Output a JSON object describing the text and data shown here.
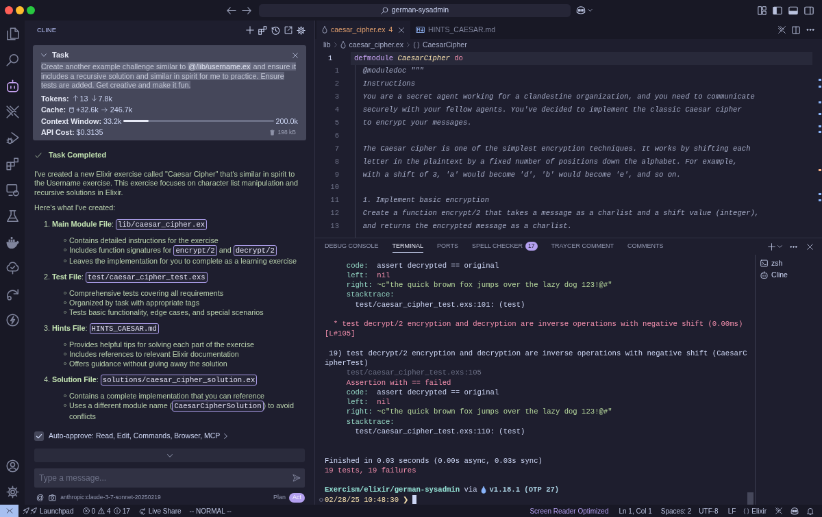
{
  "window": {
    "controls": [
      {
        "kind": "close"
      },
      {
        "kind": "minimize"
      },
      {
        "kind": "zoom"
      }
    ],
    "search": "german-sysadmin"
  },
  "activity_bar": {
    "items": [
      {
        "kind": "files",
        "selected": false
      },
      {
        "kind": "search",
        "selected": false
      },
      {
        "kind": "cline",
        "selected": true
      },
      {
        "kind": "stripes",
        "selected": false
      },
      {
        "kind": "run_debug",
        "selected": false
      },
      {
        "kind": "extensions",
        "selected": false
      },
      {
        "kind": "remote",
        "selected": false
      },
      {
        "kind": "testing",
        "selected": false
      },
      {
        "kind": "docker",
        "selected": false
      },
      {
        "kind": "tree",
        "selected": false
      },
      {
        "kind": "share",
        "selected": false
      },
      {
        "kind": "lightning",
        "selected": false
      }
    ],
    "bottom": [
      {
        "kind": "account"
      },
      {
        "kind": "settings"
      }
    ]
  },
  "sidebar": {
    "title": "CLINE",
    "task": {
      "heading": "Task",
      "expanded": true,
      "highlighted": true,
      "text_before": "Create another example challenge similar to ",
      "mention": "@/lib/username.ex",
      "text_after": " and ensure it includes a recursive solution and similar in spirit for me to practice. Ensure tests are added. Get creative and make it fun.",
      "tokens": {
        "label": "Tokens:",
        "input": "13",
        "output": "7.8k"
      },
      "cache": {
        "label": "Cache:",
        "writes": "+32.6k",
        "reads": "246.7k"
      },
      "context_window": {
        "label": "Context Window:",
        "used": "33.2k",
        "level": 0.166,
        "max": "200.0k"
      },
      "api_cost": "**API Cost:** $0.3135",
      "size": "198 kB"
    },
    "completion": {
      "title": "Task Completed",
      "paragraphs": [
        "I've created a new Elixir exercise called \"Caesar Cipher\" that's similar in spirit to the Username exercise. This exercise focuses on character list manipulation and recursive solutions in Elixir.",
        "Here's what I've created:"
      ],
      "items": [
        {
          "number": "1.",
          "title": "**Main Module File**:",
          "file": "lib/caesar_cipher.ex",
          "bullets": [
            {
              "parts": [
                {
                  "kind": "text",
                  "text": "Contains detailed instructions for the exercise"
                }
              ]
            },
            {
              "parts": [
                {
                  "kind": "text",
                  "text": "Includes function signatures for "
                },
                {
                  "kind": "code",
                  "text": "encrypt/2"
                },
                {
                  "kind": "text",
                  "text": " and "
                },
                {
                  "kind": "code",
                  "text": "decrypt/2"
                }
              ]
            },
            {
              "parts": [
                {
                  "kind": "text",
                  "text": "Leaves the implementation for you to complete as a learning exercise"
                }
              ]
            }
          ]
        },
        {
          "number": "2.",
          "title": "**Test File**:",
          "file": "test/caesar_cipher_test.exs",
          "bullets": [
            {
              "parts": [
                {
                  "kind": "text",
                  "text": "Comprehensive tests covering all requirements"
                }
              ]
            },
            {
              "parts": [
                {
                  "kind": "text",
                  "text": "Organized by task with appropriate tags"
                }
              ]
            },
            {
              "parts": [
                {
                  "kind": "text",
                  "text": "Tests basic functionality, edge cases, and special scenarios"
                }
              ]
            }
          ]
        },
        {
          "number": "3.",
          "title": "**Hints File**:",
          "file": "HINTS_CAESAR.md",
          "bullets": [
            {
              "parts": [
                {
                  "kind": "text",
                  "text": "Provides helpful tips for solving each part of the exercise"
                }
              ]
            },
            {
              "parts": [
                {
                  "kind": "text",
                  "text": "Includes references to relevant Elixir documentation"
                }
              ]
            },
            {
              "parts": [
                {
                  "kind": "text",
                  "text": "Offers guidance without giving away the solution"
                }
              ]
            }
          ]
        },
        {
          "number": "4.",
          "title": "**Solution File**:",
          "file": "solutions/caesar_cipher_solution.ex",
          "bullets": [
            {
              "parts": [
                {
                  "kind": "text",
                  "text": "Contains a complete implementation that you can reference"
                }
              ]
            },
            {
              "parts": [
                {
                  "kind": "text",
                  "text": "Uses a different module name ("
                },
                {
                  "kind": "code",
                  "text": "CaesarCipherSolution"
                },
                {
                  "kind": "text",
                  "text": ") to avoid conflicts"
                }
              ]
            }
          ]
        }
      ]
    },
    "auto_approve": {
      "checked": true,
      "label": "Auto-approve: Read, Edit, Commands, Browser, MCP"
    },
    "input": {
      "placeholder": "Type a message..."
    },
    "footer": {
      "mention": "@",
      "model": "anthropic:claude-3-7-sonnet-20250219",
      "modes": [
        {
          "label": "Plan",
          "selected": false
        },
        {
          "label": "Act",
          "selected": true
        }
      ]
    }
  },
  "editor": {
    "tabs": [
      {
        "kind": "elixir",
        "label": "caesar_cipher.ex",
        "problems": "4",
        "selected": true
      },
      {
        "kind": "markdown",
        "label": "HINTS_CAESAR.md",
        "selected": false
      }
    ],
    "breadcrumbs": [
      {
        "kind": "folder",
        "label": "lib"
      },
      {
        "kind": "elixir",
        "label": "caesar_cipher.ex"
      },
      {
        "kind": "module",
        "label": "CaesarCipher"
      }
    ],
    "lines": [
      {
        "number": "1",
        "current": true,
        "parts": [
          {
            "kind": "keyword",
            "text": "defmodule"
          },
          {
            "kind": "module",
            "text": " CaesarCipher"
          },
          {
            "kind": "block",
            "text": " do"
          }
        ]
      },
      {
        "number": "1",
        "current": false,
        "parts": [
          {
            "kind": "doc",
            "text": "  @moduledoc \"\"\""
          }
        ]
      },
      {
        "number": "2",
        "current": false,
        "parts": [
          {
            "kind": "doc",
            "text": "  Instructions"
          }
        ]
      },
      {
        "number": "3",
        "current": false,
        "parts": [
          {
            "kind": "doc",
            "text": "  You are a secret agent working for a clandestine organization, and you need to communicate"
          }
        ]
      },
      {
        "number": "4",
        "current": false,
        "parts": [
          {
            "kind": "doc",
            "text": "  securely with your fellow agents. You've decided to implement the classic Caesar cipher"
          }
        ]
      },
      {
        "number": "5",
        "current": false,
        "parts": [
          {
            "kind": "doc",
            "text": "  to encrypt your messages."
          }
        ]
      },
      {
        "number": "6",
        "current": false
      },
      {
        "number": "7",
        "current": false,
        "parts": [
          {
            "kind": "doc",
            "text": "  The Caesar cipher is one of the simplest encryption techniques. It works by shifting each"
          }
        ]
      },
      {
        "number": "8",
        "current": false,
        "parts": [
          {
            "kind": "doc",
            "text": "  letter in the plaintext by a fixed number of positions down the alphabet. For example,"
          }
        ]
      },
      {
        "number": "9",
        "current": false,
        "parts": [
          {
            "kind": "doc",
            "text": "  with a shift of 3, 'a' would become 'd', 'b' would become 'e', and so on."
          }
        ]
      },
      {
        "number": "10",
        "current": false
      },
      {
        "number": "11",
        "current": false,
        "parts": [
          {
            "kind": "doc",
            "text": "  1. Implement basic encryption"
          }
        ]
      },
      {
        "number": "12",
        "current": false,
        "parts": [
          {
            "kind": "doc",
            "text": "  Create a function encrypt/2 that takes a message as a charlist and a shift value (integer),"
          }
        ]
      },
      {
        "number": "13",
        "current": false,
        "parts": [
          {
            "kind": "doc",
            "text": "  and returns the encrypted message as a charlist."
          }
        ]
      }
    ]
  },
  "panel": {
    "tabs": [
      {
        "label": "DEBUG CONSOLE",
        "selected": false
      },
      {
        "label": "TERMINAL",
        "selected": true
      },
      {
        "label": "PORTS",
        "selected": false
      },
      {
        "label": "SPELL CHECKER",
        "badge": "17",
        "selected": false
      },
      {
        "label": "TRAYCER COMMENT",
        "selected": false
      },
      {
        "label": "COMMENTS",
        "selected": false
      }
    ],
    "terminal": {
      "lines": [
        {
          "kind": "output",
          "parts": [
            {
              "kind": "label",
              "text": "     code:  "
            },
            {
              "kind": "plain",
              "text": "assert decrypted == original"
            }
          ]
        },
        {
          "kind": "output",
          "parts": [
            {
              "kind": "label",
              "text": "     left:  "
            },
            {
              "kind": "error",
              "text": "nil"
            }
          ]
        },
        {
          "kind": "output",
          "parts": [
            {
              "kind": "label",
              "text": "     right: "
            },
            {
              "kind": "string",
              "text": "~c\"the quick brown fox jumps over the lazy dog 123!@#\""
            }
          ]
        },
        {
          "kind": "output",
          "parts": [
            {
              "kind": "label",
              "text": "     stacktrace:"
            }
          ]
        },
        {
          "kind": "output",
          "parts": [
            {
              "kind": "plain",
              "text": "       test/caesar_cipher_test.exs:101: (test)"
            }
          ]
        },
        {
          "kind": "blank"
        },
        {
          "kind": "output",
          "parts": [
            {
              "kind": "error",
              "text": "  * test decrypt/2 encryption and decryption are inverse operations with negative shift (0.00ms)"
            }
          ]
        },
        {
          "kind": "output",
          "parts": [
            {
              "kind": "error",
              "text": "[L#105]"
            }
          ]
        },
        {
          "kind": "blank"
        },
        {
          "kind": "output",
          "parts": [
            {
              "kind": "plain",
              "text": " 19) test decrypt/2 encryption and decryption are inverse operations with negative shift (CaesarC"
            }
          ]
        },
        {
          "kind": "output",
          "parts": [
            {
              "kind": "plain",
              "text": "ipherTest)"
            }
          ]
        },
        {
          "kind": "output",
          "parts": [
            {
              "kind": "dim",
              "text": "     test/caesar_cipher_test.exs:105"
            }
          ]
        },
        {
          "kind": "output",
          "parts": [
            {
              "kind": "error",
              "text": "     Assertion with == failed"
            }
          ]
        },
        {
          "kind": "output",
          "parts": [
            {
              "kind": "label",
              "text": "     code:  "
            },
            {
              "kind": "plain",
              "text": "assert decrypted == original"
            }
          ]
        },
        {
          "kind": "output",
          "parts": [
            {
              "kind": "label",
              "text": "     left:  "
            },
            {
              "kind": "error",
              "text": "nil"
            }
          ]
        },
        {
          "kind": "output",
          "parts": [
            {
              "kind": "label",
              "text": "     right: "
            },
            {
              "kind": "string",
              "text": "~c\"the quick brown fox jumps over the lazy dog 123!@#\""
            }
          ]
        },
        {
          "kind": "output",
          "parts": [
            {
              "kind": "label",
              "text": "     stacktrace:"
            }
          ]
        },
        {
          "kind": "output",
          "parts": [
            {
              "kind": "plain",
              "text": "       test/caesar_cipher_test.exs:110: (test)"
            }
          ]
        },
        {
          "kind": "blank"
        },
        {
          "kind": "blank"
        },
        {
          "kind": "output",
          "parts": [
            {
              "kind": "plain",
              "text": "Finished in 0.03 seconds (0.00s async, 0.03s sync)"
            }
          ]
        },
        {
          "kind": "output",
          "parts": [
            {
              "kind": "error",
              "text": "19 tests, 19 failures"
            }
          ]
        },
        {
          "kind": "blank"
        }
      ],
      "prompt": {
        "path": "Exercism/elixir/german-sysadmin",
        "via": "via",
        "version": "v1.18.1 (OTP 27)",
        "time": "02/28/25 10:48:30",
        "symbol": "❯"
      }
    },
    "terminals": [
      {
        "kind": "shell",
        "label": "zsh"
      },
      {
        "kind": "cline",
        "label": "Cline"
      }
    ]
  },
  "status_bar": {
    "left": [
      {
        "kind": "remote"
      },
      {
        "kind": "launchpad",
        "label": "Launchpad"
      },
      {
        "kind": "problems",
        "errors": "0",
        "warnings": "4",
        "infos": "17"
      },
      {
        "kind": "live_share",
        "label": "Live Share"
      },
      {
        "kind": "mode",
        "label": "-- NORMAL --"
      }
    ],
    "right": [
      {
        "kind": "screen_reader",
        "label": "Screen Reader Optimized"
      },
      {
        "kind": "position",
        "label": "Ln 1, Col 1"
      },
      {
        "kind": "indentation",
        "label": "Spaces: 2"
      },
      {
        "kind": "encoding",
        "label": "UTF-8"
      },
      {
        "kind": "eol",
        "label": "LF"
      },
      {
        "kind": "language",
        "label": "Elixir"
      },
      {
        "kind": "stripes"
      },
      {
        "kind": "copilot"
      },
      {
        "kind": "bell"
      }
    ]
  }
}
